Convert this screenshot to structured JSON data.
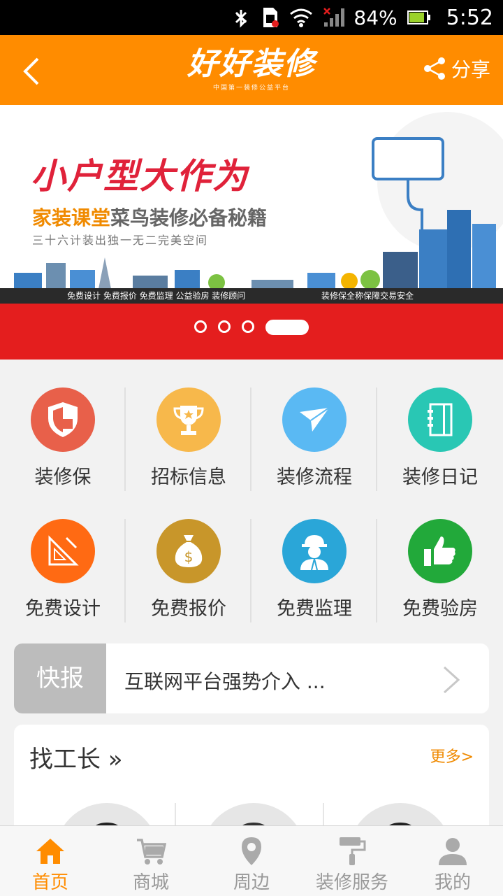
{
  "status_bar": {
    "battery": "84%",
    "time": "5:52"
  },
  "header": {
    "logo": "好好装修",
    "logo_sub": "中国第一装修公益平台",
    "share_label": "分享"
  },
  "banner": {
    "title": "小户型大作为",
    "subtitle_orange": "家装课堂",
    "subtitle_gray": "菜鸟装修必备秘籍",
    "slogan": "三十六计装出独一无二完美空间",
    "strip_left": "免费设计  免费报价  免费监理  公益验房  装修顾问",
    "strip_right": "装修保全称保障交易安全",
    "slide_count": 4,
    "active_slide": 4
  },
  "features": [
    {
      "label": "装修保",
      "color": "#e8604a",
      "icon": "shield-icon"
    },
    {
      "label": "招标信息",
      "color": "#f7b84b",
      "icon": "trophy-icon"
    },
    {
      "label": "装修流程",
      "color": "#5ab9f3",
      "icon": "paper-plane-icon"
    },
    {
      "label": "装修日记",
      "color": "#29c7b4",
      "icon": "notebook-icon"
    },
    {
      "label": "免费设计",
      "color": "#ff6a13",
      "icon": "ruler-icon"
    },
    {
      "label": "免费报价",
      "color": "#c8962a",
      "icon": "money-bag-icon"
    },
    {
      "label": "免费监理",
      "color": "#2aa6d8",
      "icon": "worker-icon"
    },
    {
      "label": "免费验房",
      "color": "#22a93a",
      "icon": "thumbs-up-icon"
    }
  ],
  "news": {
    "tag": "快报",
    "headline": "互联网平台强势介入 ..."
  },
  "foremen": {
    "title": "找工长 »",
    "more": "更多>"
  },
  "tabs": [
    {
      "label": "首页",
      "icon": "home-icon",
      "active": true
    },
    {
      "label": "商城",
      "icon": "cart-icon",
      "active": false
    },
    {
      "label": "周边",
      "icon": "location-pin-icon",
      "active": false
    },
    {
      "label": "装修服务",
      "icon": "paint-roller-icon",
      "active": false
    },
    {
      "label": "我的",
      "icon": "person-icon",
      "active": false
    }
  ],
  "colors": {
    "accent": "#ff8c00",
    "banner_red": "#e41e1e"
  }
}
